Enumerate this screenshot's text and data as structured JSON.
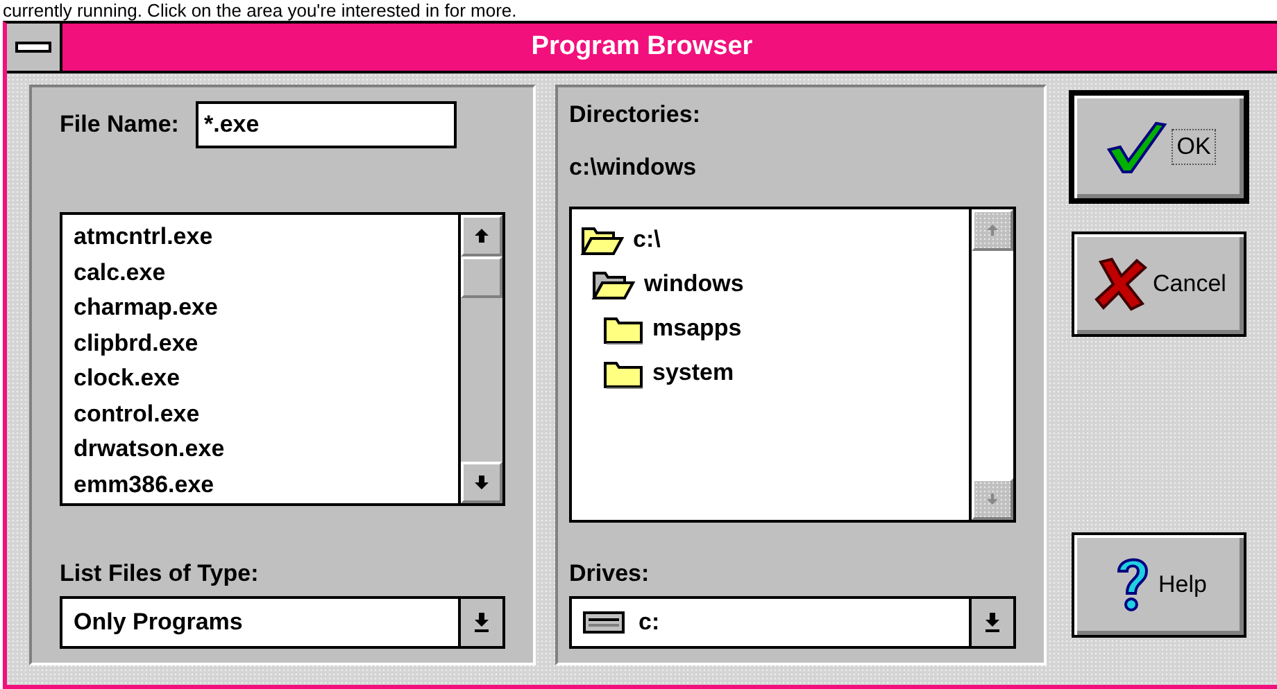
{
  "caption_above": "currently running. Click on the area you're interested in for more.",
  "window": {
    "title": "Program Browser"
  },
  "file_name": {
    "label": "File Name:",
    "value": "*.exe"
  },
  "files": [
    {
      "name": "atmcntrl.exe",
      "selected": false
    },
    {
      "name": "calc.exe",
      "selected": false
    },
    {
      "name": "charmap.exe",
      "selected": false
    },
    {
      "name": "clipbrd.exe",
      "selected": false
    },
    {
      "name": "clock.exe",
      "selected": false
    },
    {
      "name": "control.exe",
      "selected": false
    },
    {
      "name": "drwatson.exe",
      "selected": false
    },
    {
      "name": "emm386.exe",
      "selected": false
    }
  ],
  "file_type": {
    "label": "List Files of Type:",
    "value": "Only Programs"
  },
  "directories": {
    "label": "Directories:",
    "path": "c:\\windows",
    "tree": [
      {
        "name": "c:\\",
        "expanded": true,
        "selected": false,
        "children": [
          {
            "name": "windows",
            "expanded": true,
            "selected": true,
            "children": [
              {
                "name": "msapps",
                "expanded": false,
                "selected": false
              },
              {
                "name": "system",
                "expanded": false,
                "selected": false
              }
            ]
          }
        ]
      }
    ]
  },
  "drives": {
    "label": "Drives:",
    "value": "c:"
  },
  "buttons": [
    {
      "label": "OK",
      "kind": "ok",
      "default": true
    },
    {
      "label": "Cancel",
      "kind": "cancel",
      "default": false
    },
    {
      "label": "Help",
      "kind": "help",
      "default": false
    }
  ]
}
